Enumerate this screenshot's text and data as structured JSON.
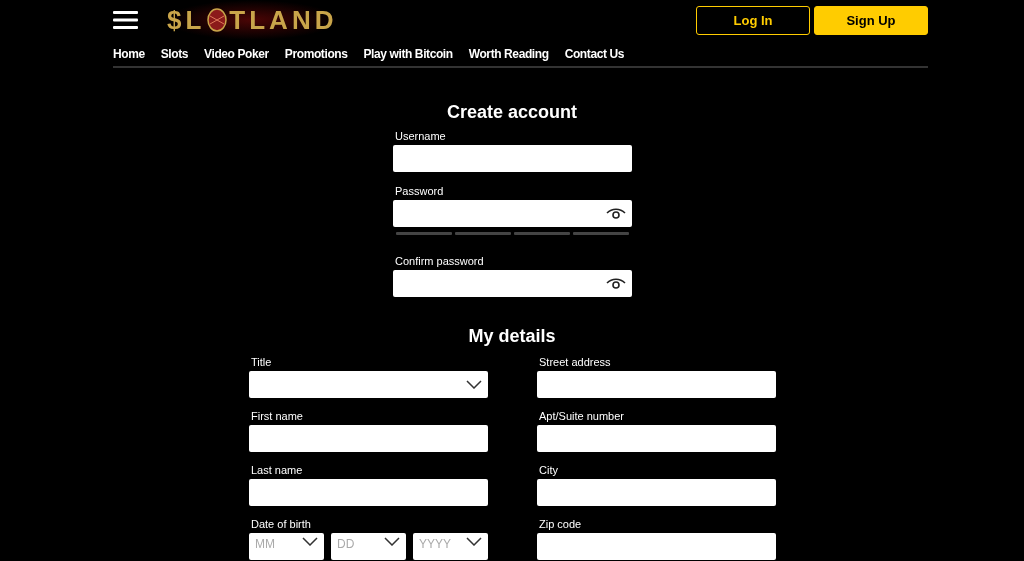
{
  "header": {
    "logo": {
      "before": "$L",
      "after": "TLAND"
    },
    "buttons": [
      {
        "label": "Log In",
        "kind": "outline"
      },
      {
        "label": "Sign Up",
        "kind": "filled"
      }
    ]
  },
  "nav": [
    "Home",
    "Slots",
    "Video Poker",
    "Promotions",
    "Play with Bitcoin",
    "Worth Reading",
    "Contact Us"
  ],
  "account": {
    "title": "Create account",
    "fields": [
      {
        "label": "Username",
        "kind": "text"
      },
      {
        "label": "Password",
        "kind": "password"
      },
      {
        "label": "Confirm password",
        "kind": "password"
      }
    ]
  },
  "details": {
    "title": "My details",
    "left": [
      {
        "label": "Title",
        "kind": "select"
      },
      {
        "label": "First name",
        "kind": "text"
      },
      {
        "label": "Last name",
        "kind": "text"
      },
      {
        "label": "Date of birth",
        "kind": "date",
        "parts": [
          "MM",
          "DD",
          "YYYY"
        ]
      }
    ],
    "right": [
      {
        "label": "Street address",
        "kind": "text"
      },
      {
        "label": "Apt/Suite number",
        "kind": "text"
      },
      {
        "label": "City",
        "kind": "text"
      },
      {
        "label": "Zip code",
        "kind": "text"
      }
    ]
  }
}
